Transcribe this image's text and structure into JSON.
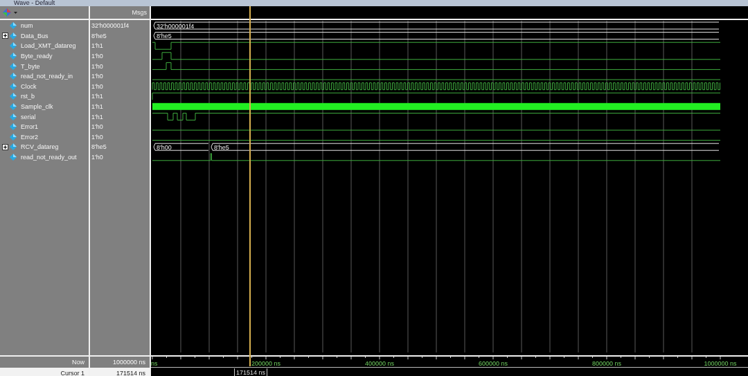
{
  "window": {
    "title": "Wave - Default"
  },
  "header": {
    "messages_label": "Msgs"
  },
  "signals": [
    {
      "name": "num",
      "value": "32'h000001f4",
      "kind": "bus",
      "segments": [
        "32'h000001f4"
      ]
    },
    {
      "name": "Data_Bus",
      "value": "8'he5",
      "kind": "bus",
      "expanded": false,
      "segments": [
        "8'he5"
      ]
    },
    {
      "name": "Load_XMT_datareg",
      "value": "1'h1",
      "kind": "dip"
    },
    {
      "name": "Byte_ready",
      "value": "1'h0",
      "kind": "pulse"
    },
    {
      "name": "T_byte",
      "value": "1'h0",
      "kind": "short-pulse"
    },
    {
      "name": "read_not_ready_in",
      "value": "1'h0",
      "kind": "low"
    },
    {
      "name": "Clock",
      "value": "1'h0",
      "kind": "clock"
    },
    {
      "name": "rst_b",
      "value": "1'h1",
      "kind": "high"
    },
    {
      "name": "Sample_clk",
      "value": "1'h1",
      "kind": "dense"
    },
    {
      "name": "serial",
      "value": "1'h1",
      "kind": "serial"
    },
    {
      "name": "Error1",
      "value": "1'h0",
      "kind": "low"
    },
    {
      "name": "Error2",
      "value": "1'h0",
      "kind": "low"
    },
    {
      "name": "RCV_datareg",
      "value": "8'he5",
      "kind": "bus",
      "expanded": false,
      "segments": [
        "8'h00",
        "8'he5"
      ]
    },
    {
      "name": "read_not_ready_out",
      "value": "1'h0",
      "kind": "spike"
    }
  ],
  "time_axis": {
    "start_label": "ns",
    "labels": [
      "200000 ns",
      "400000 ns",
      "600000 ns",
      "800000 ns",
      "1000000 ns"
    ]
  },
  "now": {
    "label": "Now",
    "value": "1000000 ns"
  },
  "cursor": {
    "label": "Cursor 1",
    "value": "171514 ns",
    "tag": "171514 ns"
  }
}
